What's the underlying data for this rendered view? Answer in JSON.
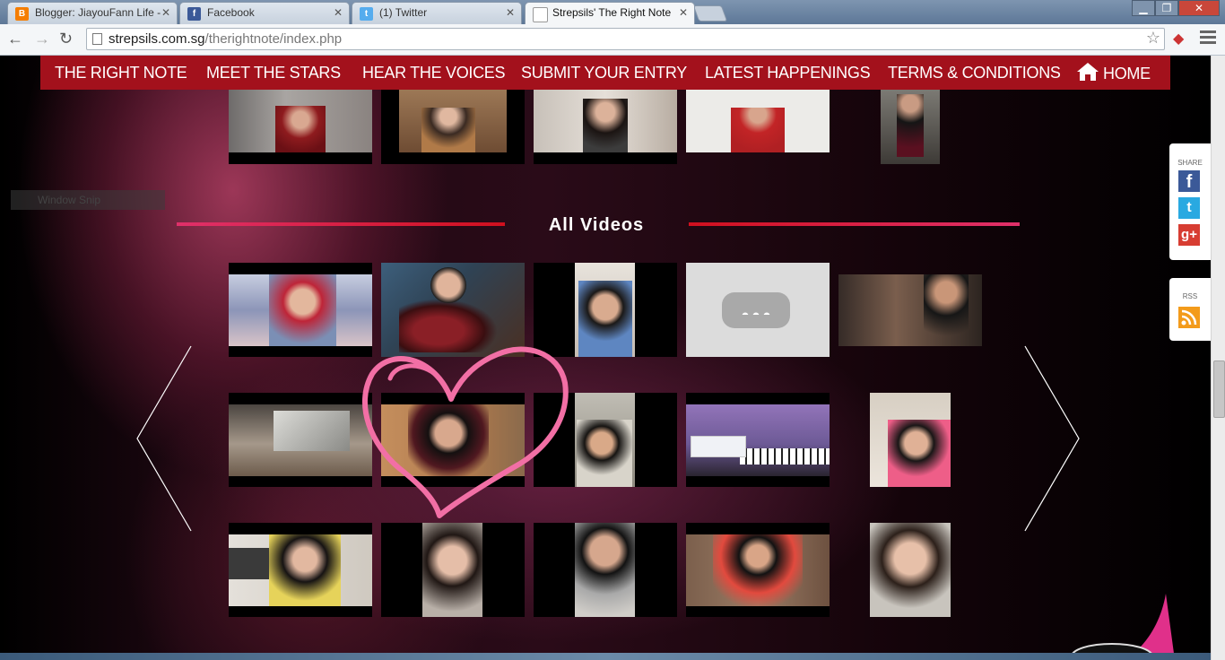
{
  "browser": {
    "tabs": [
      {
        "title": "Blogger: JiayouFann Life -",
        "icon": "blogger-icon",
        "color": "#f57d00"
      },
      {
        "title": "Facebook",
        "icon": "facebook-icon",
        "color": "#3b5998"
      },
      {
        "title": "(1) Twitter",
        "icon": "twitter-icon",
        "color": "#55acee"
      },
      {
        "title": "Strepsils' The Right Note",
        "icon": "page-icon",
        "color": "#cccccc"
      }
    ],
    "url_host": "strepsils.com.sg",
    "url_path": "/therightnote/index.php"
  },
  "nav": {
    "items": [
      "THE RIGHT NOTE",
      "MEET THE STARS",
      "HEAR THE VOICES",
      "SUBMIT YOUR ENTRY",
      "LATEST HAPPENINGS",
      "TERMS & CONDITIONS"
    ],
    "home": "HOME",
    "bar_color": "#a3111c"
  },
  "section": {
    "title": "All Videos",
    "divider_left_color": "#e0306a",
    "divider_right_color": "#d0101e"
  },
  "overlay": {
    "window_snip": "Window Snip",
    "heart_color": "#f26fa5"
  },
  "share": {
    "label": "SHARE",
    "rss_label": "RSS",
    "icons": [
      "facebook-icon",
      "twitter-icon",
      "google-plus-icon",
      "rss-icon"
    ]
  }
}
